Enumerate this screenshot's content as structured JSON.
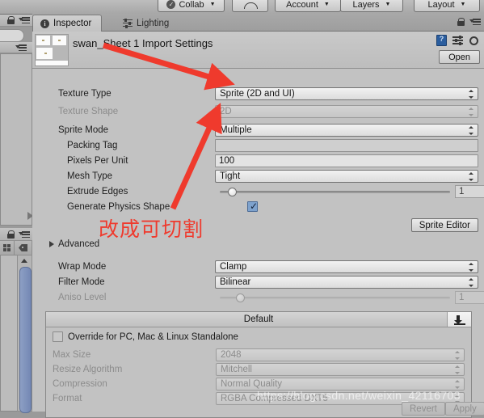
{
  "toolbar": {
    "buttons": [
      {
        "name": "collab",
        "label": "Collab",
        "icon": "collab-check-icon",
        "caret": true
      },
      {
        "name": "cloud",
        "label": "",
        "icon": "cloud-icon",
        "caret": false
      },
      {
        "name": "account",
        "label": "Account",
        "icon": "",
        "caret": true
      },
      {
        "name": "layers",
        "label": "Layers",
        "icon": "",
        "caret": true
      },
      {
        "name": "layout",
        "label": "Layout",
        "icon": "",
        "caret": true
      }
    ]
  },
  "inspector": {
    "tabs": [
      {
        "label": "Inspector",
        "icon": "info-circle-icon",
        "active": true
      },
      {
        "label": "Lighting",
        "icon": "lighting-sliders-icon",
        "active": false
      }
    ],
    "title": "swan_Sheet 1 Import Settings",
    "header_icons": [
      "help-book-icon",
      "preset-icon",
      "gear-icon"
    ],
    "open_label": "Open"
  },
  "fields": {
    "texture_type": {
      "label": "Texture Type",
      "value": "Sprite (2D and UI)",
      "type": "popup",
      "disabled": false
    },
    "texture_shape": {
      "label": "Texture Shape",
      "value": "2D",
      "type": "popup",
      "disabled": true
    },
    "sprite_mode": {
      "label": "Sprite Mode",
      "value": "Multiple",
      "type": "popup",
      "disabled": false
    },
    "packing_tag": {
      "label": "Packing Tag",
      "value": "",
      "placeholder": "",
      "type": "text",
      "disabled": false
    },
    "pixels_per_unit": {
      "label": "Pixels Per Unit",
      "value": "100",
      "type": "text",
      "disabled": false
    },
    "mesh_type": {
      "label": "Mesh Type",
      "value": "Tight",
      "type": "popup",
      "disabled": false
    },
    "extrude_edges": {
      "label": "Extrude Edges",
      "value": "1",
      "type": "slider",
      "disabled": false,
      "percent": 4
    },
    "generate_physics_shape": {
      "label": "Generate Physics Shape",
      "checked": true,
      "type": "checkbox"
    },
    "sprite_editor": {
      "label": "Sprite Editor",
      "type": "button"
    },
    "advanced": {
      "label": "Advanced",
      "type": "foldout",
      "expanded": false
    },
    "wrap_mode": {
      "label": "Wrap Mode",
      "value": "Clamp",
      "type": "popup",
      "disabled": false
    },
    "filter_mode": {
      "label": "Filter Mode",
      "value": "Bilinear",
      "type": "popup",
      "disabled": false
    },
    "aniso_level": {
      "label": "Aniso Level",
      "value": "1",
      "type": "slider",
      "disabled": true,
      "percent": 8
    }
  },
  "platform": {
    "tab_label": "Default",
    "download_icon": "download-icon",
    "override": {
      "label": "Override for PC, Mac & Linux Standalone",
      "checked": false
    },
    "rows": [
      {
        "label": "Max Size",
        "value": "2048"
      },
      {
        "label": "Resize Algorithm",
        "value": "Mitchell"
      },
      {
        "label": "Compression",
        "value": "Normal Quality"
      },
      {
        "label": "Format",
        "value": "RGBA Compressed DXT5"
      }
    ]
  },
  "footer": {
    "revert_label": "Revert",
    "apply_label": "Apply"
  },
  "annotation": {
    "text": "改成可切割",
    "color": "#ef3a2d",
    "arrow_color": "#ef3a2d"
  },
  "watermark": {
    "text": "https://blog.csdn.net/weixin_42116703"
  },
  "colors": {
    "window_bg": "#c2c2c2",
    "outer_bg": "#9a9a9a",
    "checkbox_blue": "#7ea2cd",
    "scrollbar_blue": "#7488b4",
    "accent_red": "#ef3a2d"
  }
}
